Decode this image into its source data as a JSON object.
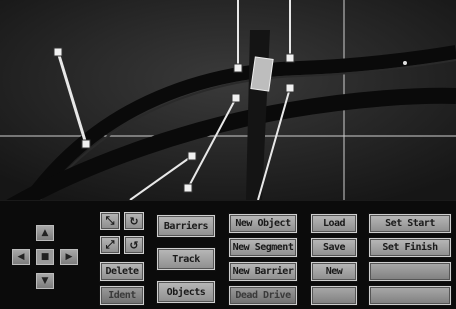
{
  "viewport": {
    "label": "track-editor-view"
  },
  "controls": {
    "dpad": {
      "up": "▲",
      "down": "▼",
      "left": "◀",
      "right": "▶",
      "center": "■"
    },
    "icons": {
      "shrink": "⤡",
      "rotate_cw": "↻",
      "expand": "⤢",
      "rotate_ccw": "↺"
    },
    "delete_label": "Delete",
    "lower_left_label": "Ident"
  },
  "modes": {
    "barriers": "Barriers",
    "track": "Track",
    "objects": "Objects"
  },
  "create": {
    "new_object": "New Object",
    "new_segment": "New Segment",
    "new_barrier": "New Barrier",
    "bottom": "Dead Drive"
  },
  "file": {
    "load": "Load",
    "save": "Save",
    "new": "New",
    "bottom": ""
  },
  "right_column": {
    "row1": "Set Start",
    "row2": "Set Finish",
    "row3": "",
    "row4": ""
  }
}
